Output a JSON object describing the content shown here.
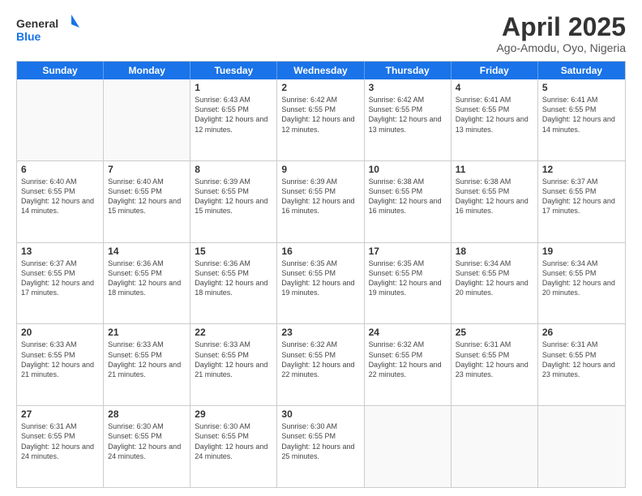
{
  "logo": {
    "text_general": "General",
    "text_blue": "Blue"
  },
  "title": "April 2025",
  "subtitle": "Ago-Amodu, Oyo, Nigeria",
  "days": [
    "Sunday",
    "Monday",
    "Tuesday",
    "Wednesday",
    "Thursday",
    "Friday",
    "Saturday"
  ],
  "weeks": [
    [
      {
        "day": "",
        "info": ""
      },
      {
        "day": "",
        "info": ""
      },
      {
        "day": "1",
        "info": "Sunrise: 6:43 AM\nSunset: 6:55 PM\nDaylight: 12 hours and 12 minutes."
      },
      {
        "day": "2",
        "info": "Sunrise: 6:42 AM\nSunset: 6:55 PM\nDaylight: 12 hours and 12 minutes."
      },
      {
        "day": "3",
        "info": "Sunrise: 6:42 AM\nSunset: 6:55 PM\nDaylight: 12 hours and 13 minutes."
      },
      {
        "day": "4",
        "info": "Sunrise: 6:41 AM\nSunset: 6:55 PM\nDaylight: 12 hours and 13 minutes."
      },
      {
        "day": "5",
        "info": "Sunrise: 6:41 AM\nSunset: 6:55 PM\nDaylight: 12 hours and 14 minutes."
      }
    ],
    [
      {
        "day": "6",
        "info": "Sunrise: 6:40 AM\nSunset: 6:55 PM\nDaylight: 12 hours and 14 minutes."
      },
      {
        "day": "7",
        "info": "Sunrise: 6:40 AM\nSunset: 6:55 PM\nDaylight: 12 hours and 15 minutes."
      },
      {
        "day": "8",
        "info": "Sunrise: 6:39 AM\nSunset: 6:55 PM\nDaylight: 12 hours and 15 minutes."
      },
      {
        "day": "9",
        "info": "Sunrise: 6:39 AM\nSunset: 6:55 PM\nDaylight: 12 hours and 16 minutes."
      },
      {
        "day": "10",
        "info": "Sunrise: 6:38 AM\nSunset: 6:55 PM\nDaylight: 12 hours and 16 minutes."
      },
      {
        "day": "11",
        "info": "Sunrise: 6:38 AM\nSunset: 6:55 PM\nDaylight: 12 hours and 16 minutes."
      },
      {
        "day": "12",
        "info": "Sunrise: 6:37 AM\nSunset: 6:55 PM\nDaylight: 12 hours and 17 minutes."
      }
    ],
    [
      {
        "day": "13",
        "info": "Sunrise: 6:37 AM\nSunset: 6:55 PM\nDaylight: 12 hours and 17 minutes."
      },
      {
        "day": "14",
        "info": "Sunrise: 6:36 AM\nSunset: 6:55 PM\nDaylight: 12 hours and 18 minutes."
      },
      {
        "day": "15",
        "info": "Sunrise: 6:36 AM\nSunset: 6:55 PM\nDaylight: 12 hours and 18 minutes."
      },
      {
        "day": "16",
        "info": "Sunrise: 6:35 AM\nSunset: 6:55 PM\nDaylight: 12 hours and 19 minutes."
      },
      {
        "day": "17",
        "info": "Sunrise: 6:35 AM\nSunset: 6:55 PM\nDaylight: 12 hours and 19 minutes."
      },
      {
        "day": "18",
        "info": "Sunrise: 6:34 AM\nSunset: 6:55 PM\nDaylight: 12 hours and 20 minutes."
      },
      {
        "day": "19",
        "info": "Sunrise: 6:34 AM\nSunset: 6:55 PM\nDaylight: 12 hours and 20 minutes."
      }
    ],
    [
      {
        "day": "20",
        "info": "Sunrise: 6:33 AM\nSunset: 6:55 PM\nDaylight: 12 hours and 21 minutes."
      },
      {
        "day": "21",
        "info": "Sunrise: 6:33 AM\nSunset: 6:55 PM\nDaylight: 12 hours and 21 minutes."
      },
      {
        "day": "22",
        "info": "Sunrise: 6:33 AM\nSunset: 6:55 PM\nDaylight: 12 hours and 21 minutes."
      },
      {
        "day": "23",
        "info": "Sunrise: 6:32 AM\nSunset: 6:55 PM\nDaylight: 12 hours and 22 minutes."
      },
      {
        "day": "24",
        "info": "Sunrise: 6:32 AM\nSunset: 6:55 PM\nDaylight: 12 hours and 22 minutes."
      },
      {
        "day": "25",
        "info": "Sunrise: 6:31 AM\nSunset: 6:55 PM\nDaylight: 12 hours and 23 minutes."
      },
      {
        "day": "26",
        "info": "Sunrise: 6:31 AM\nSunset: 6:55 PM\nDaylight: 12 hours and 23 minutes."
      }
    ],
    [
      {
        "day": "27",
        "info": "Sunrise: 6:31 AM\nSunset: 6:55 PM\nDaylight: 12 hours and 24 minutes."
      },
      {
        "day": "28",
        "info": "Sunrise: 6:30 AM\nSunset: 6:55 PM\nDaylight: 12 hours and 24 minutes."
      },
      {
        "day": "29",
        "info": "Sunrise: 6:30 AM\nSunset: 6:55 PM\nDaylight: 12 hours and 24 minutes."
      },
      {
        "day": "30",
        "info": "Sunrise: 6:30 AM\nSunset: 6:55 PM\nDaylight: 12 hours and 25 minutes."
      },
      {
        "day": "",
        "info": ""
      },
      {
        "day": "",
        "info": ""
      },
      {
        "day": "",
        "info": ""
      }
    ]
  ]
}
